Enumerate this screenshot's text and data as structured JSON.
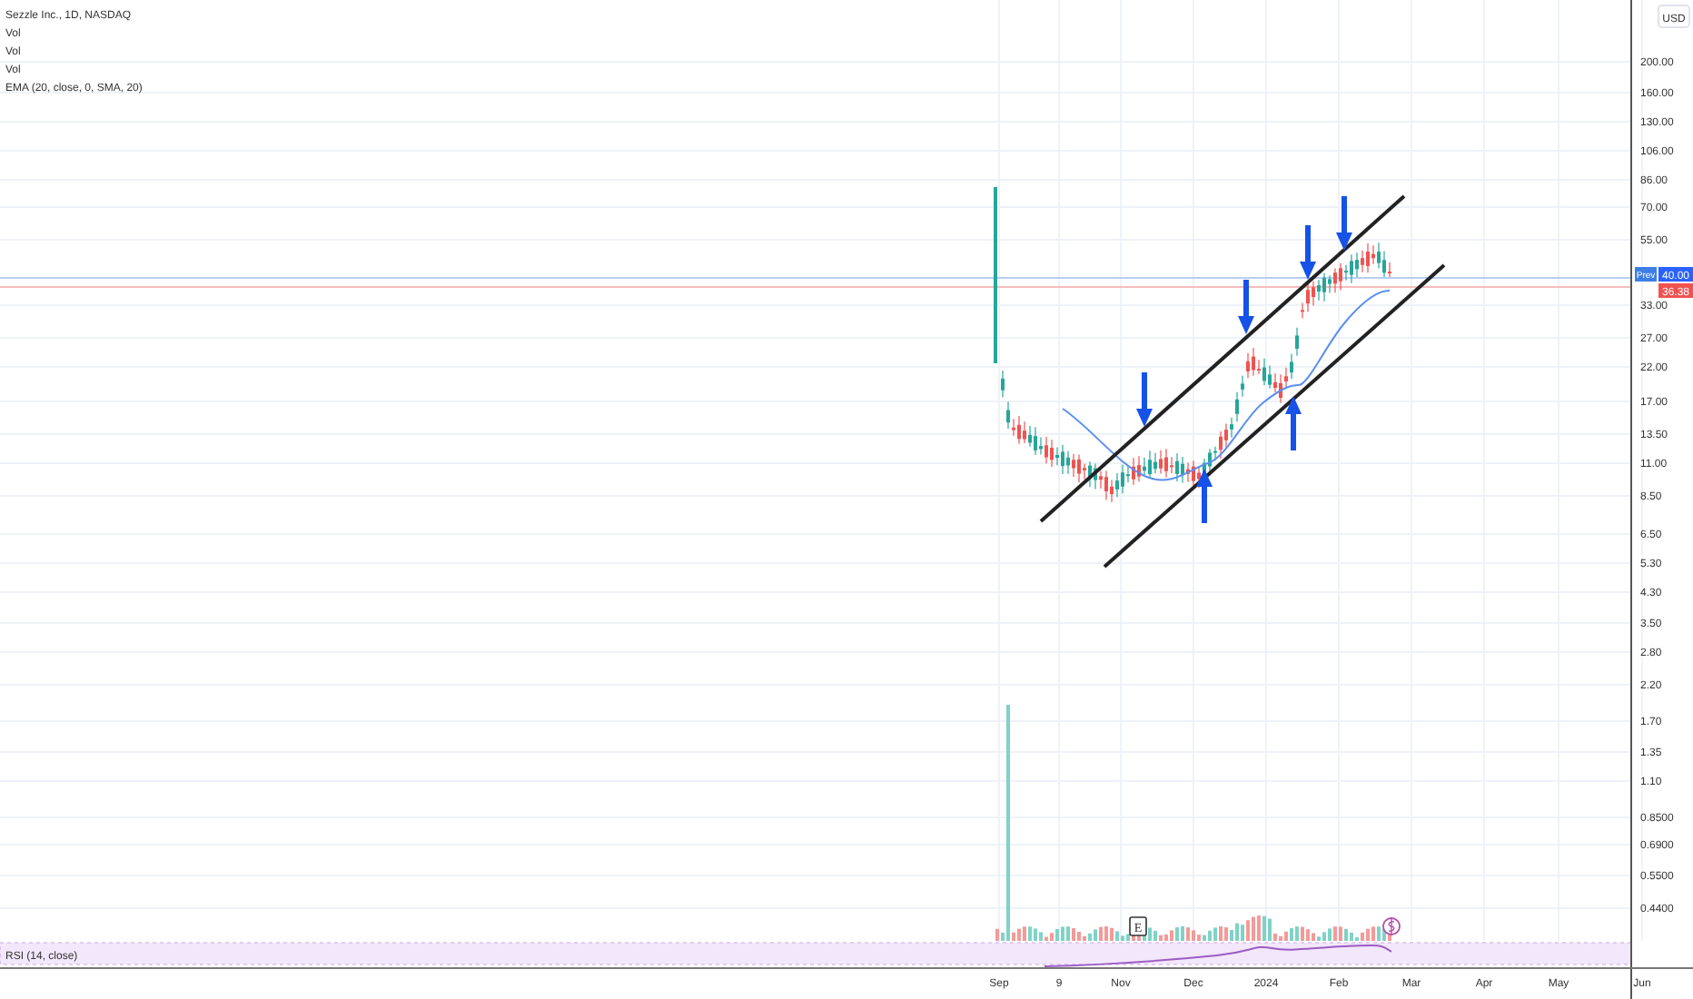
{
  "legend": {
    "title": "Sezzle Inc., 1D, NASDAQ",
    "indicators": [
      "Vol",
      "Vol",
      "Vol",
      "EMA (20, close, 0, SMA, 20)"
    ]
  },
  "price_axis": {
    "currency": "USD",
    "labels": [
      "200.00",
      "160.00",
      "130.00",
      "106.00",
      "86.00",
      "70.00",
      "55.00",
      "33.00",
      "27.00",
      "22.00",
      "17.00",
      "13.50",
      "11.00",
      "8.50",
      "6.50",
      "5.30",
      "4.30",
      "3.50",
      "2.80",
      "2.20",
      "1.70",
      "1.35",
      "1.10",
      "0.8500",
      "0.6900",
      "0.5500",
      "0.4400"
    ]
  },
  "price_tags": {
    "prev_label": "Prev",
    "prev_close": "40.00",
    "last": "36.38"
  },
  "events": {
    "earnings": "E"
  },
  "rsi": {
    "label": "RSI (14, close)"
  },
  "time_axis": [
    "Sep",
    "9",
    "Nov",
    "Dec",
    "2024",
    "Feb",
    "Mar",
    "Apr",
    "May",
    "Jun"
  ]
}
